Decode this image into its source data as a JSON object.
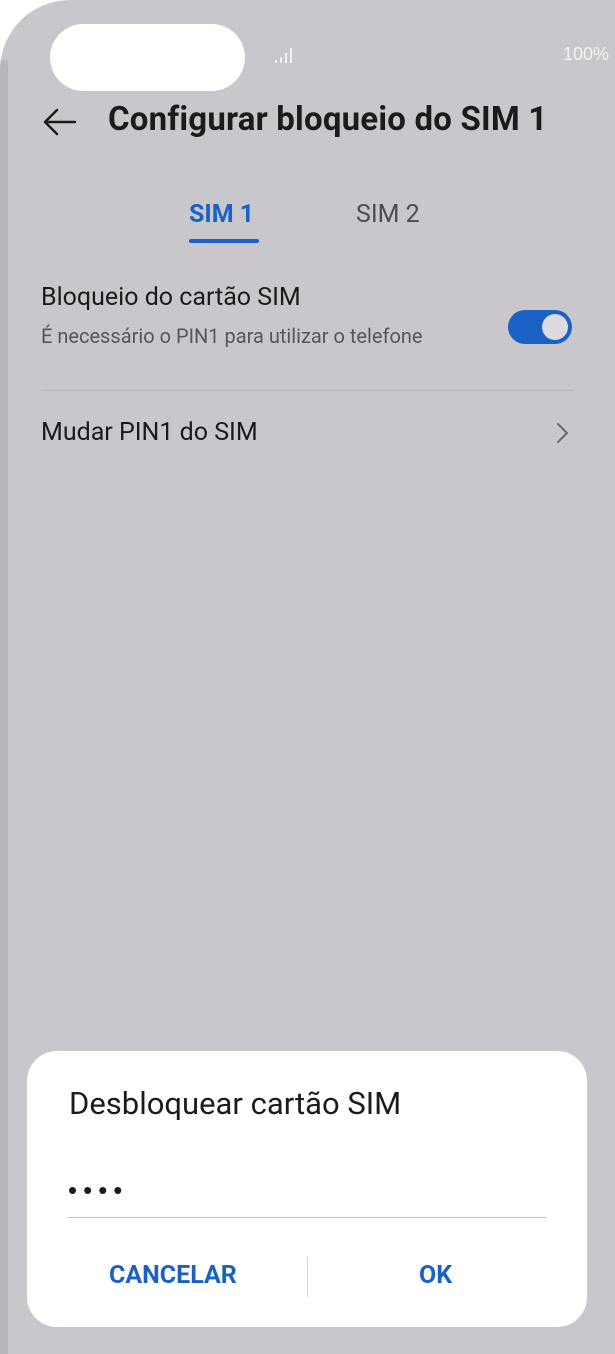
{
  "status_bar": {
    "battery": "100%"
  },
  "header": {
    "title": "Configurar bloqueio do SIM 1"
  },
  "tabs": [
    {
      "label": "SIM 1",
      "selected": true
    },
    {
      "label": "SIM 2",
      "selected": false
    }
  ],
  "settings": {
    "sim_lock": {
      "title": "Bloqueio do cartão SIM",
      "subtitle": "É necessário o PIN1 para utilizar o telefone",
      "enabled": true
    },
    "change_pin": {
      "title": "Mudar PIN1 do SIM"
    }
  },
  "dialog": {
    "title": "Desbloquear cartão SIM",
    "pin_value": "••••",
    "cancel_label": "CANCELAR",
    "ok_label": "OK"
  },
  "colors": {
    "accent": "#1a61c6",
    "background": "#c9c7cb",
    "dialog_bg": "#ffffff"
  },
  "icons": {
    "back": "arrow-left-icon",
    "chevron": "chevron-right-icon",
    "signal": "signal-icon"
  }
}
